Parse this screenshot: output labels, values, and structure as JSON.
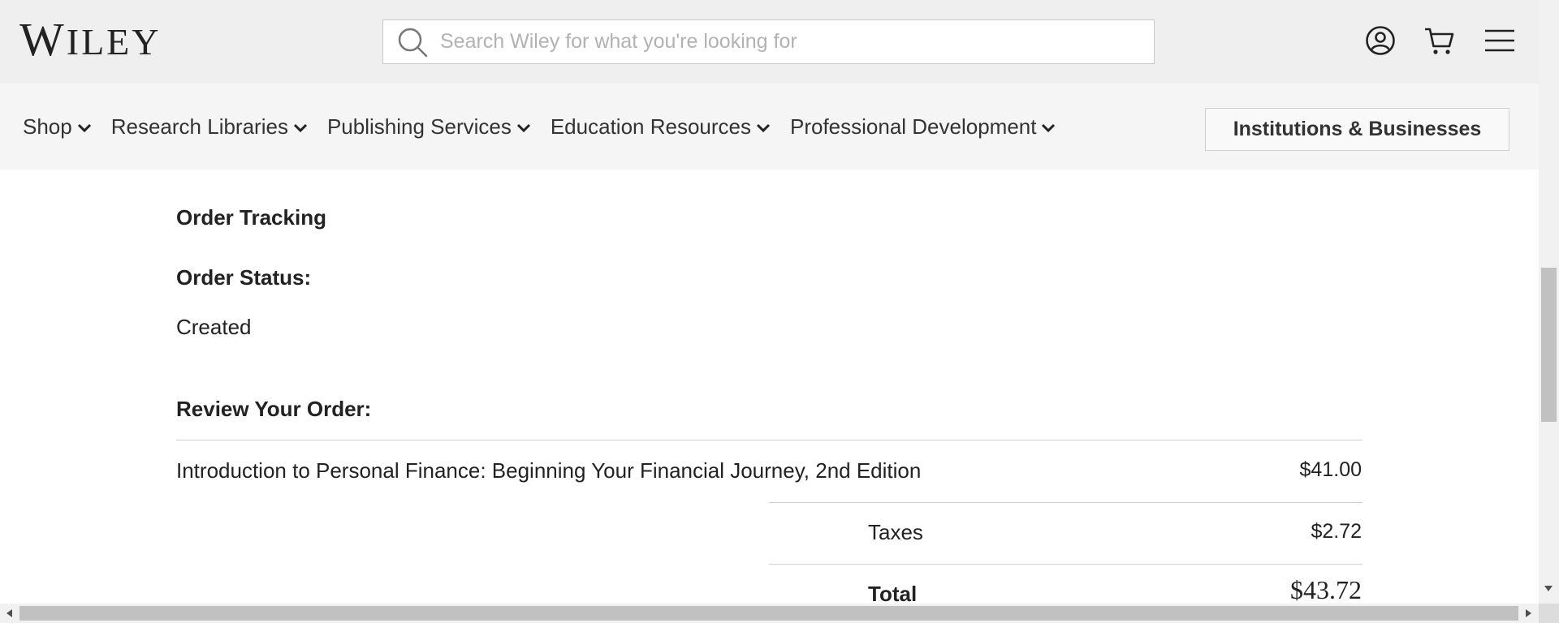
{
  "header": {
    "logo_initial": "W",
    "logo_rest": "ILEY",
    "search": {
      "placeholder": "Search Wiley for what you're looking for",
      "value": ""
    },
    "icons": [
      "account-icon",
      "cart-icon",
      "menu-icon"
    ]
  },
  "nav": {
    "items": [
      {
        "label": "Shop"
      },
      {
        "label": "Research Libraries"
      },
      {
        "label": "Publishing Services"
      },
      {
        "label": "Education Resources"
      },
      {
        "label": "Professional Development"
      }
    ],
    "institutions_button": "Institutions & Businesses"
  },
  "order": {
    "tracking_heading": "Order Tracking",
    "status_heading": "Order Status:",
    "status_value": "Created",
    "review_heading": "Review Your Order:",
    "item": {
      "name": "Introduction to Personal Finance: Beginning Your Financial Journey, 2nd Edition",
      "price": "$41.00"
    },
    "taxes_label": "Taxes",
    "taxes_value": "$2.72",
    "total_label": "Total",
    "total_value": "$43.72"
  },
  "colors": {
    "header_bg": "#efefef",
    "nav_bg": "#f5f5f5",
    "text": "#222222",
    "divider": "#cfcfcf"
  }
}
